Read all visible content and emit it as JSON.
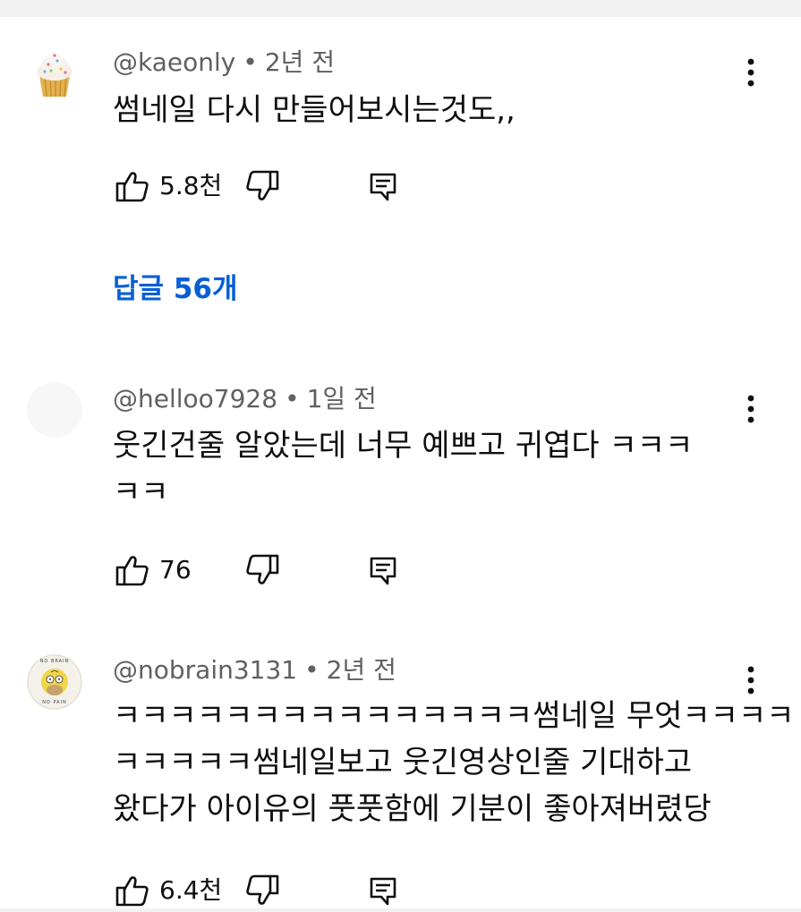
{
  "comments": [
    {
      "handle": "@kaeonly",
      "age": "2년 전",
      "lines": [
        "썸네일 다시 만들어보시는것도,,"
      ],
      "likes": "5.8천",
      "avatar": "cupcake-avatar",
      "replies_label": "답글 56개"
    },
    {
      "handle": "@helloo7928",
      "age": "1일 전",
      "lines": [
        "웃긴건줄 알았는데 너무 예쁘고 귀엽다 ㅋㅋㅋ",
        "ㅋㅋ"
      ],
      "likes": "76",
      "avatar": "blank-avatar"
    },
    {
      "handle": "@nobrain3131",
      "age": "2년 전",
      "lines": [
        "ㅋㅋㅋㅋㅋㅋㅋㅋㅋㅋㅋㅋㅋㅋㅋ썸네일 무엇ㅋㅋㅋㅋ",
        "ㅋㅋㅋㅋㅋ썸네일보고 웃긴영상인줄 기대하고",
        "왔다가 아이유의 풋풋함에 기분이 좋아져버렸당"
      ],
      "likes": "6.4천",
      "avatar": "homer-no-brain-avatar",
      "avatar_text_top": "NO BRAIN",
      "avatar_text_bottom": "NO PAIN"
    }
  ],
  "separator": "•",
  "colors": {
    "text": "#0f0f0f",
    "meta": "#606060",
    "link": "#065fd4",
    "strip": "#f2f2f2"
  }
}
